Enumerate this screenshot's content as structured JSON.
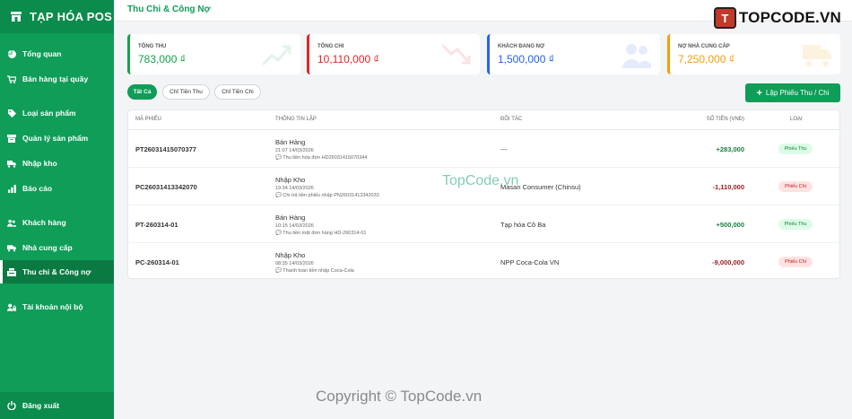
{
  "sidebar": {
    "brand": "TẠP HÓA POS",
    "items": [
      {
        "label": "Tổng quan",
        "icon": "chart-pie-icon"
      },
      {
        "label": "Bán hàng tại quầy",
        "icon": "cart-icon"
      },
      {
        "label": "Loại sản phẩm",
        "icon": "tag-icon"
      },
      {
        "label": "Quản lý sản phẩm",
        "icon": "box-icon"
      },
      {
        "label": "Nhập kho",
        "icon": "truck-loading-icon"
      },
      {
        "label": "Báo cáo",
        "icon": "report-icon"
      },
      {
        "label": "Khách hàng",
        "icon": "users-icon"
      },
      {
        "label": "Nhà cung cấp",
        "icon": "truck-icon"
      },
      {
        "label": "Thu chi & Công nợ",
        "icon": "cash-register-icon",
        "active": true
      },
      {
        "label": "Tài khoản nội bộ",
        "icon": "user-lock-icon"
      }
    ],
    "logout": "Đăng xuất"
  },
  "header": {
    "title": "Thu Chi & Công Nợ",
    "logo_text": "TOPCODE.VN",
    "logo_mark": "T"
  },
  "stats": [
    {
      "label": "Tổng thu",
      "value": "783,000 ₫",
      "color": "#16a34a",
      "icon": "trend-up-icon"
    },
    {
      "label": "Tổng chi",
      "value": "10,110,000 ₫",
      "color": "#dc2626",
      "icon": "trend-down-icon"
    },
    {
      "label": "Khách đang nợ",
      "value": "1,500,000 ₫",
      "color": "#2563eb",
      "icon": "users-icon"
    },
    {
      "label": "Nợ nhà cung cấp",
      "value": "7,250,000 ₫",
      "color": "#f59e0b",
      "icon": "truck-icon"
    }
  ],
  "filters": {
    "tabs": [
      "Tất Cả",
      "Chỉ Tiền Thu",
      "Chỉ Tiền Chi"
    ],
    "active": "Tất Cả",
    "create_label": "Lập Phiếu Thu / Chi"
  },
  "table": {
    "columns": [
      "Mã phiếu",
      "Thông tin lập",
      "Đối tác",
      "Số tiền (VNĐ)",
      "Loại"
    ],
    "rows": [
      {
        "code": "PT26031415070377",
        "title": "Bán Hàng",
        "time": "21:07 14/03/2026",
        "note": "Thu tiền hóa đơn HD26031415070344",
        "partner": "---",
        "amount": "+283,000",
        "type": "Phiếu Thu",
        "kind": "thu"
      },
      {
        "code": "PC26031413342070",
        "title": "Nhập Kho",
        "time": "19:34 14/03/2026",
        "note": "Chi trả tiền phiếu nhập PN26031413342033",
        "partner": "Masan Consumer (Chinsu)",
        "amount": "-1,110,000",
        "type": "Phiếu Chi",
        "kind": "chi"
      },
      {
        "code": "PT-260314-01",
        "title": "Bán Hàng",
        "time": "10:15 14/03/2026",
        "note": "Thu tiền mặt đơn hàng HD-260314-01",
        "partner": "Tạp hóa Cô Ba",
        "amount": "+500,000",
        "type": "Phiếu Thu",
        "kind": "thu"
      },
      {
        "code": "PC-260314-01",
        "title": "Nhập Kho",
        "time": "08:35 14/03/2026",
        "note": "Thanh toán tiền nhập Coca-Cola",
        "partner": "NPP Coca-Cola VN",
        "amount": "-9,000,000",
        "type": "Phiếu Chi",
        "kind": "chi"
      }
    ]
  },
  "watermarks": {
    "center": "TopCode.vn",
    "bottom": "Copyright © TopCode.vn"
  },
  "colors": {
    "primary": "#0f9d58",
    "positive": "#15803d",
    "negative": "#991b1b"
  }
}
